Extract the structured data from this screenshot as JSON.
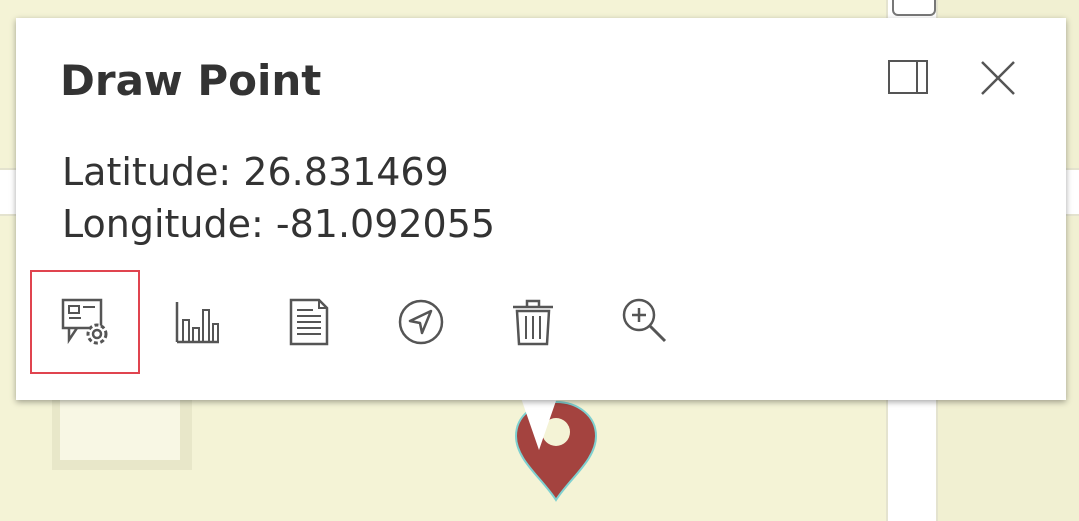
{
  "popup": {
    "title": "Draw Point",
    "latitude": "Latitude: 26.831469",
    "longitude": "Longitude: -81.092055"
  },
  "header_actions": {
    "dock": "dock-icon",
    "close": "close-icon"
  },
  "actions": [
    {
      "icon": "edit-settings-icon",
      "selected": true
    },
    {
      "icon": "bar-chart-icon",
      "selected": false
    },
    {
      "icon": "document-icon",
      "selected": false
    },
    {
      "icon": "navigate-icon",
      "selected": false
    },
    {
      "icon": "trash-icon",
      "selected": false
    },
    {
      "icon": "zoom-in-icon",
      "selected": false
    }
  ],
  "colors": {
    "map_background": "#f4f3d6",
    "pin": "#a4433f",
    "selection_outline": "#e0444f",
    "text": "#333333"
  }
}
